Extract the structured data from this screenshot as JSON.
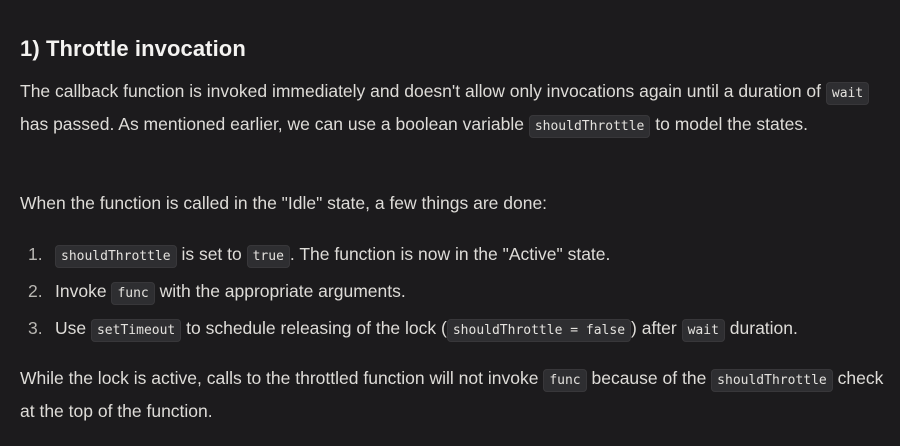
{
  "heading": "1) Throttle invocation",
  "para1": {
    "text_a": "The callback function is invoked immediately and doesn't allow only invocations again until a duration of ",
    "code_a": "wait",
    "text_b": " has passed. As mentioned earlier, we can use a boolean variable ",
    "code_b": "shouldThrottle",
    "text_c": " to model the states."
  },
  "para2": "When the function is called in the \"Idle\" state, a few things are done:",
  "list": [
    {
      "num": "1.",
      "code_a": "shouldThrottle",
      "text_a": " is set to ",
      "code_b": "true",
      "text_b": ". The function is now in the \"Active\" state."
    },
    {
      "num": "2.",
      "text_a": "Invoke ",
      "code_a": "func",
      "text_b": " with the appropriate arguments."
    },
    {
      "num": "3.",
      "text_a": "Use ",
      "code_a": "setTimeout",
      "text_b": " to schedule releasing of the lock (",
      "code_b": "shouldThrottle = false",
      "text_c": ") after ",
      "code_c": "wait",
      "text_d": " duration."
    }
  ],
  "para3": {
    "text_a": "While the lock is active, calls to the throttled function will not invoke ",
    "code_a": "func",
    "text_b": " because of the ",
    "code_b": "shouldThrottle",
    "text_c": " check at the top of the function."
  }
}
